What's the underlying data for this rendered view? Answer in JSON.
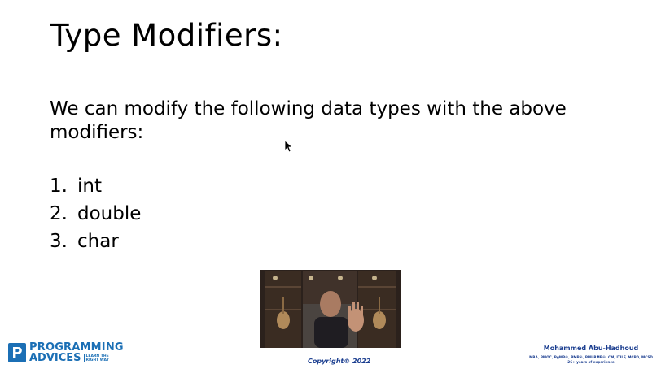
{
  "slide": {
    "title": "Type Modifiers:",
    "intro": "We can modify the following data types with the above modifiers:",
    "list": [
      {
        "num": "1.",
        "text": "int"
      },
      {
        "num": "2.",
        "text": "double"
      },
      {
        "num": "3.",
        "text": "char"
      }
    ]
  },
  "footer": {
    "logo_line1": "PROGRAMMING",
    "logo_line2": "ADVICES",
    "logo_tagline": "LEARN THE RIGHT WAY",
    "copyright": "Copyright© 2022",
    "presenter_name": "Mohammed Abu-Hadhoud",
    "presenter_creds": "MBA, PMOC, PgMP®, PMP®, PMI-RMP®, CM, ITILF, MCPD, MCSD",
    "presenter_exp": "26+ years of experience"
  },
  "colors": {
    "brand_blue": "#1b6fb5",
    "footer_navy": "#1a3d8f"
  },
  "icons": {
    "cursor": "mouse-pointer-icon",
    "logo": "programming-advices-logo-icon"
  }
}
